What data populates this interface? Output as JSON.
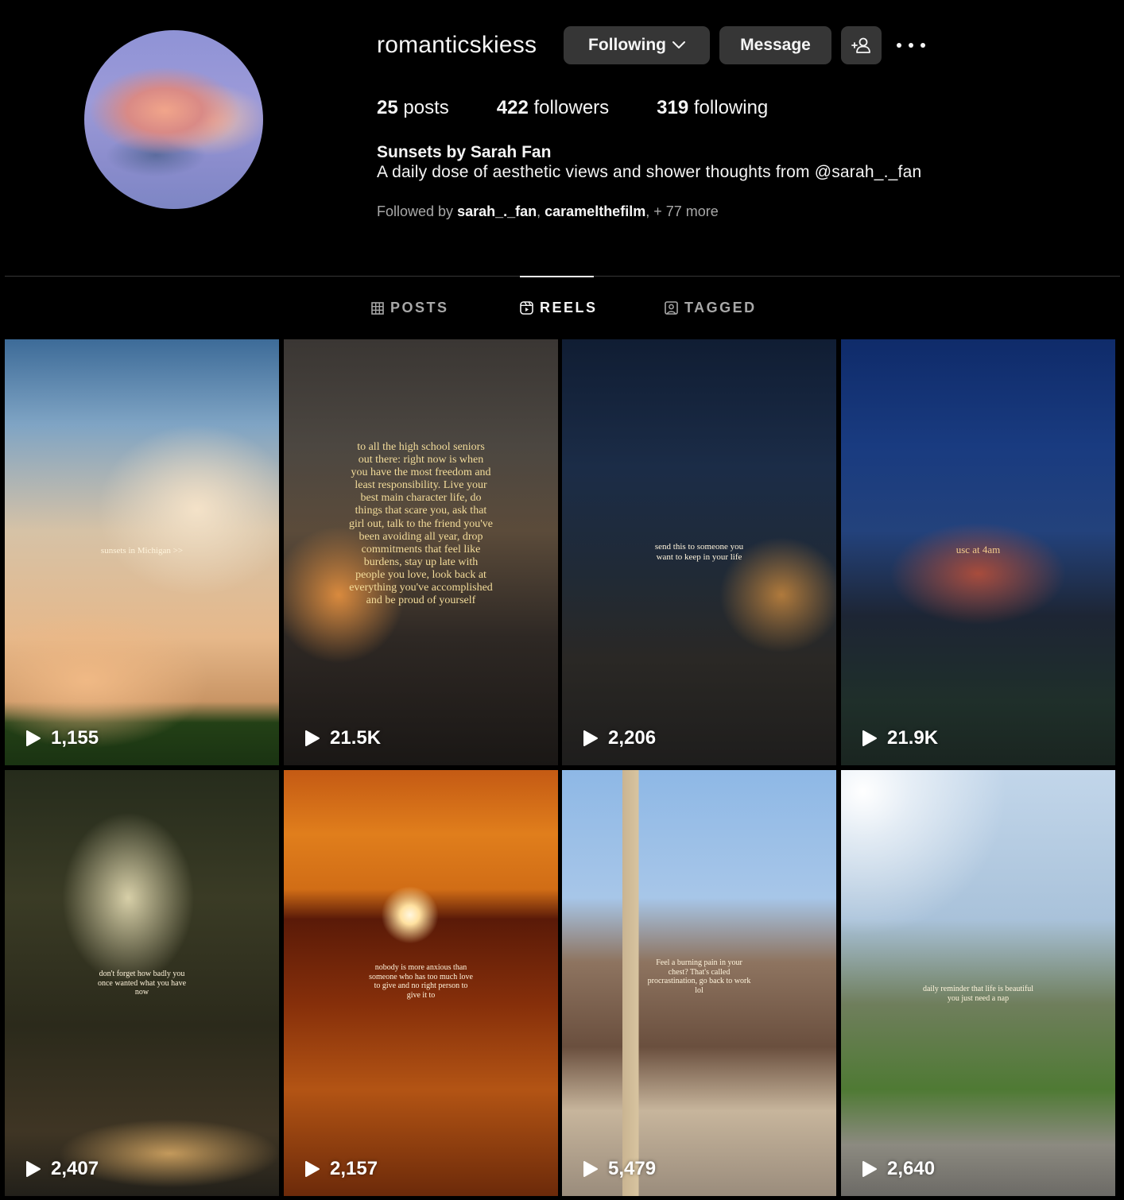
{
  "profile": {
    "username": "romanticskiess",
    "buttons": {
      "following": "Following",
      "message": "Message"
    },
    "stats": {
      "posts_count": "25",
      "posts_label": "posts",
      "followers_count": "422",
      "followers_label": "followers",
      "following_count": "319",
      "following_label": "following"
    },
    "full_name": "Sunsets by Sarah Fan",
    "bio": "A daily dose of aesthetic views and shower thoughts from @sarah_._fan",
    "followed_by": {
      "prefix": "Followed by",
      "user1": "sarah_._fan",
      "user2": "caramelthefilm",
      "more": "+ 77 more"
    }
  },
  "tabs": [
    {
      "label": "POSTS",
      "icon": "grid-icon",
      "active": false
    },
    {
      "label": "REELS",
      "icon": "reels-icon",
      "active": true
    },
    {
      "label": "TAGGED",
      "icon": "tagged-icon",
      "active": false
    }
  ],
  "reels": [
    {
      "views": "1,155",
      "caption": "sunsets in Michigan >>"
    },
    {
      "views": "21.5K",
      "caption": "to all the high school seniors out there: right now is when you have the most freedom and least responsibility. Live your best main character life, do things that scare you, ask that girl out, talk to the friend you've been avoiding all year, drop commitments that feel like burdens, stay up late with people you love, look back at everything you've accomplished and be proud of yourself"
    },
    {
      "views": "2,206",
      "caption": "send this to someone you want to keep in your life"
    },
    {
      "views": "21.9K",
      "caption": "usc at 4am"
    },
    {
      "views": "2,407",
      "caption": "don't forget how badly you once wanted what you have now"
    },
    {
      "views": "2,157",
      "caption": "nobody is more anxious than someone who has too much love to give and no right person to give it to"
    },
    {
      "views": "5,479",
      "caption": "Feel a burning pain in your chest? That's called procrastination, go back to work lol"
    },
    {
      "views": "2,640",
      "caption": "daily reminder that life is beautiful you just need a nap"
    }
  ],
  "colors": {
    "background": "#000000",
    "button_bg": "#363636",
    "text_primary": "#f5f5f5",
    "text_secondary": "#a8a8a8"
  }
}
